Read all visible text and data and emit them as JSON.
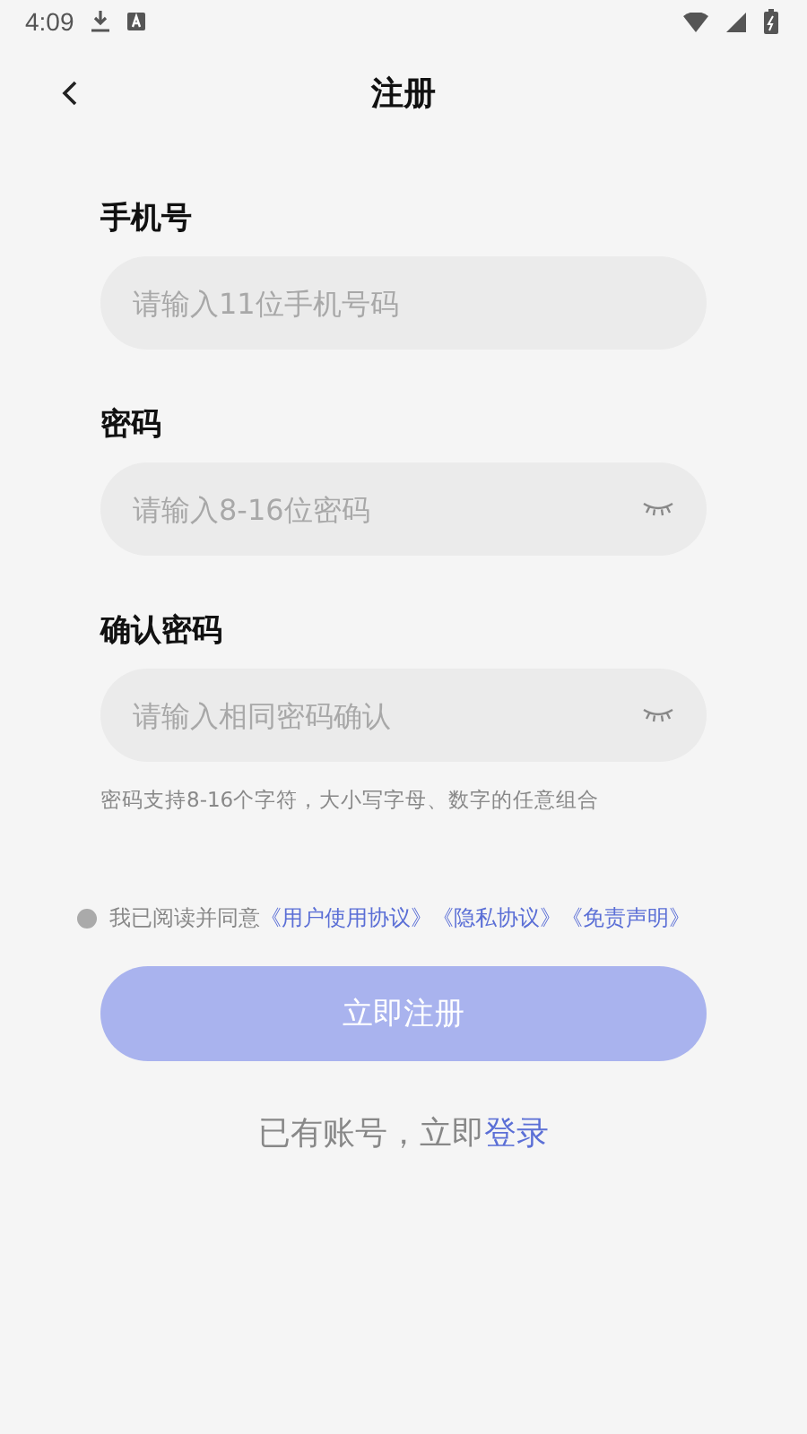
{
  "status_bar": {
    "time": "4:09"
  },
  "header": {
    "title": "注册"
  },
  "fields": [
    {
      "label": "手机号",
      "placeholder": "请输入11位手机号码",
      "password": false
    },
    {
      "label": "密码",
      "placeholder": "请输入8-16位密码",
      "password": true
    },
    {
      "label": "确认密码",
      "placeholder": "请输入相同密码确认",
      "password": true
    }
  ],
  "hint": "密码支持8-16个字符，大小写字母、数字的任意组合",
  "agreement": {
    "checked": false,
    "text": "我已阅读并同意",
    "links": [
      "《用户使用协议》",
      "《隐私协议》",
      "《免责声明》"
    ]
  },
  "submit": {
    "label": "立即注册",
    "disabled": true
  },
  "login_prompt": {
    "text": "已有账号，立即",
    "link": "登录"
  }
}
